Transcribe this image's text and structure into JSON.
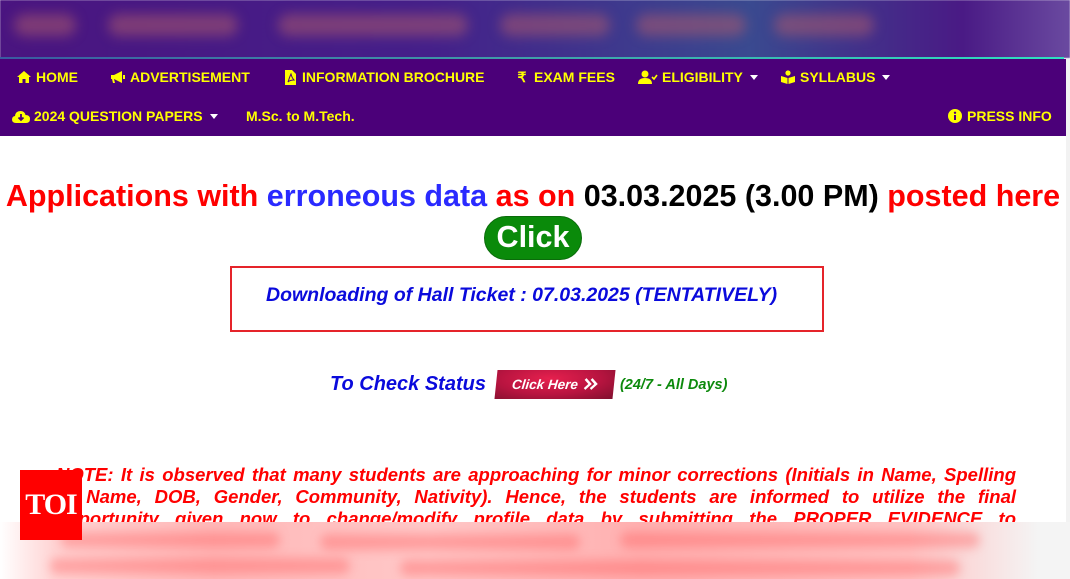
{
  "nav": {
    "row1": [
      {
        "icon": "home-icon",
        "glyph": "⌂",
        "label": "HOME",
        "dropdown": false
      },
      {
        "icon": "bullhorn-icon",
        "glyph": "📢",
        "label": "ADVERTISEMENT",
        "dropdown": false
      },
      {
        "icon": "pdf-file-icon",
        "glyph": "📄",
        "label": "INFORMATION BROCHURE",
        "dropdown": false
      },
      {
        "icon": "rupee-icon",
        "glyph": "₹",
        "label": "EXAM FEES",
        "dropdown": false
      },
      {
        "icon": "user-check-icon",
        "glyph": "👤",
        "label": "ELIGIBILITY",
        "dropdown": true
      },
      {
        "icon": "book-reader-icon",
        "glyph": "📖",
        "label": "SYLLABUS",
        "dropdown": true
      }
    ],
    "row2": [
      {
        "icon": "cloud-download-icon",
        "glyph": "☁",
        "label": "2024 QUESTION PAPERS",
        "dropdown": true
      },
      {
        "icon": "",
        "glyph": "",
        "label": "M.Sc. to M.Tech.",
        "dropdown": false
      }
    ],
    "press_info": {
      "icon": "info-circle-icon",
      "glyph": "ℹ",
      "label": "PRESS INFO"
    }
  },
  "headline": {
    "part1": "Applications with ",
    "part2": "erroneous data",
    "part3": " as on ",
    "part4": "03.03.2025 (3.00 PM)",
    "part5": " posted here ",
    "click_label": "Click"
  },
  "hall_ticket": {
    "text": "Downloading of Hall Ticket : 07.03.2025 (TENTATIVELY)"
  },
  "status": {
    "label": "To Check Status",
    "button_label": "Click Here",
    "button_icon": "»",
    "availability": "(24/7 - All Days)"
  },
  "note": {
    "lines": [
      "NOTE: It is observed that many students are approaching for minor corrections (Initials in Name, Spelling",
      "of Name, DOB, Gender, Community, Nativity). Hence, the students are informed to utilize the final",
      "opportunity given now to change/modify profile data by submitting the PROPER EVIDENCE to"
    ]
  },
  "watermark": {
    "label": "TOI"
  },
  "colors": {
    "nav_bg": "#4b0079",
    "nav_text": "#ffff00",
    "headline_red": "#ff0000",
    "headline_blue": "#2a2aff",
    "click_green": "#0a8a0a",
    "hall_box_border": "#e5242a",
    "hall_text_blue": "#0a0adc",
    "status_green": "#0d8a0d",
    "click_here_red": "#b81440"
  }
}
